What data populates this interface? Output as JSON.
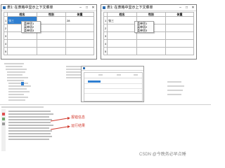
{
  "window_title": "表1: 在表格中显示上下文菜单",
  "grid": {
    "headers": [
      "姓名",
      "性别",
      "体重"
    ],
    "row_numbers": [
      "1",
      "2",
      "3",
      "4",
      "5"
    ],
    "left_cell": "张三",
    "weight_value": "28",
    "right_cell": "张三"
  },
  "context_menu": [
    "菜单项1",
    "菜单项2",
    "菜单项3"
  ],
  "annotations": {
    "arrow_1": "报错信息",
    "arrow_2": "运行结果"
  },
  "watermark": "CSDN @今晚务必早点睡",
  "colors": {
    "accent_blue": "#2f7fd1",
    "annotation_red": "#d23a2e"
  }
}
